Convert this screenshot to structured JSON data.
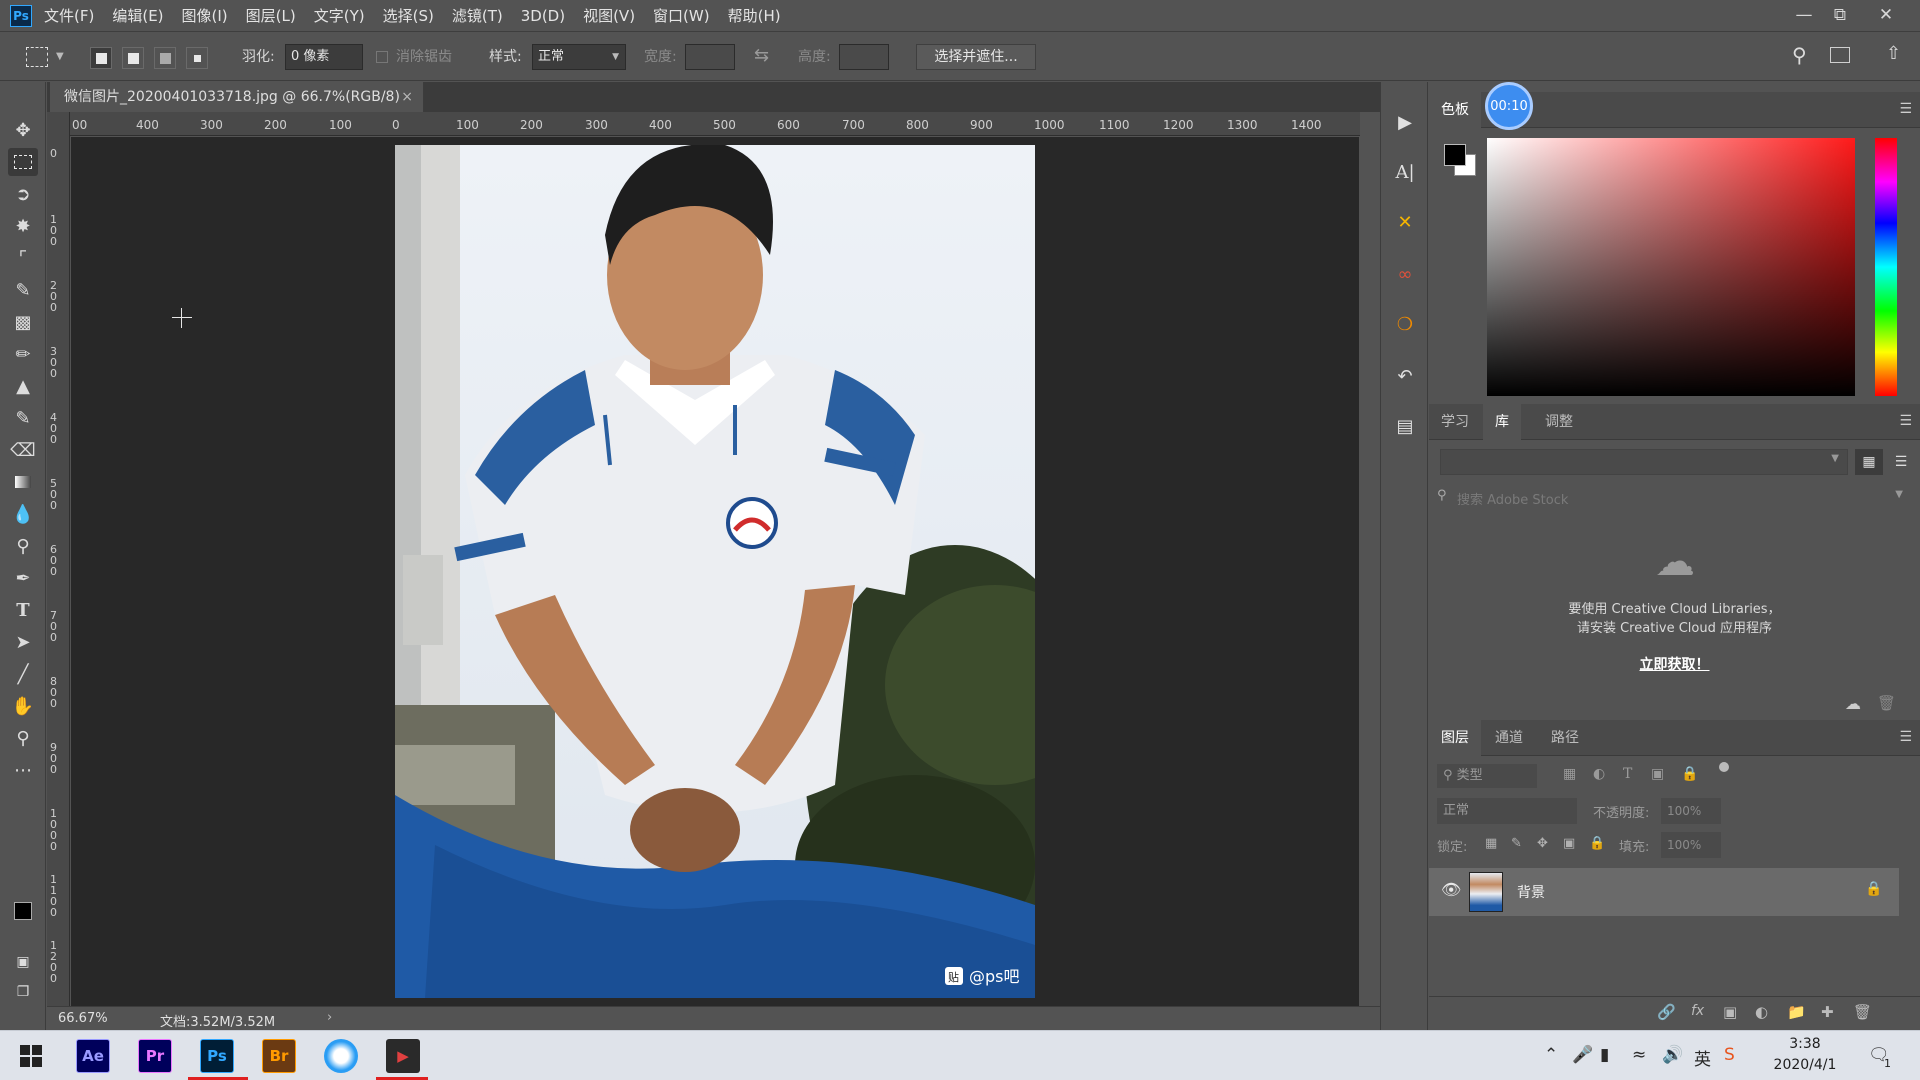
{
  "menubar": {
    "app_logo": "Ps",
    "items": [
      "文件(F)",
      "编辑(E)",
      "图像(I)",
      "图层(L)",
      "文字(Y)",
      "选择(S)",
      "滤镜(T)",
      "3D(D)",
      "视图(V)",
      "窗口(W)",
      "帮助(H)"
    ]
  },
  "options": {
    "feather_label": "羽化:",
    "feather_value": "0 像素",
    "antialias_label": "消除锯齿",
    "style_label": "样式:",
    "style_value": "正常",
    "width_label": "宽度:",
    "height_label": "高度:",
    "select_mask_button": "选择并遮住..."
  },
  "document": {
    "tab_title": "微信图片_20200401033718.jpg @ 66.7%(RGB/8)",
    "close": "×",
    "zoom": "66.67%",
    "doc_size": "文档:3.52M/3.52M",
    "watermark": "@ps吧",
    "watermark_badge": "贴"
  },
  "rulers": {
    "h_labels": [
      "00",
      "400",
      "300",
      "200",
      "100",
      "0",
      "100",
      "200",
      "300",
      "400",
      "500",
      "600",
      "700",
      "800",
      "900",
      "1000",
      "1100",
      "1200",
      "1300",
      "1400"
    ],
    "v_labels": [
      "0",
      "100",
      "200",
      "300",
      "400",
      "500",
      "600",
      "700",
      "800",
      "900",
      "1000",
      "1100",
      "1200"
    ]
  },
  "color_panel": {
    "tab": "色板",
    "timer": "00:10"
  },
  "library_panel": {
    "tabs": [
      "学习",
      "库",
      "调整"
    ],
    "active_tab": "库",
    "search_placeholder": "搜索 Adobe Stock",
    "message_line1": "要使用 Creative Cloud Libraries，",
    "message_line2": "请安装 Creative Cloud 应用程序",
    "get_now": "立即获取！"
  },
  "layers_panel": {
    "tabs": [
      "图层",
      "通道",
      "路径"
    ],
    "active_tab": "图层",
    "filter_kind": "类型",
    "blend_mode": "正常",
    "opacity_label": "不透明度:",
    "opacity_value": "100%",
    "lock_label": "锁定:",
    "fill_label": "填充:",
    "fill_value": "100%",
    "layers": [
      {
        "name": "背景",
        "visible": true,
        "locked": true
      }
    ]
  },
  "taskbar": {
    "apps": [
      "Ae",
      "Pr",
      "Ps",
      "Br"
    ],
    "active_app": "Ps",
    "ime": "英",
    "time": "3:38",
    "date": "2020/4/1",
    "notification_count": "1"
  },
  "colors": {
    "ui_bg": "#535353",
    "canvas_bg": "#282828",
    "ps_blue": "#31a8ff",
    "ae_purple": "#9999ff",
    "pr_purple": "#ea77ff",
    "br_orange": "#ff9a00"
  }
}
